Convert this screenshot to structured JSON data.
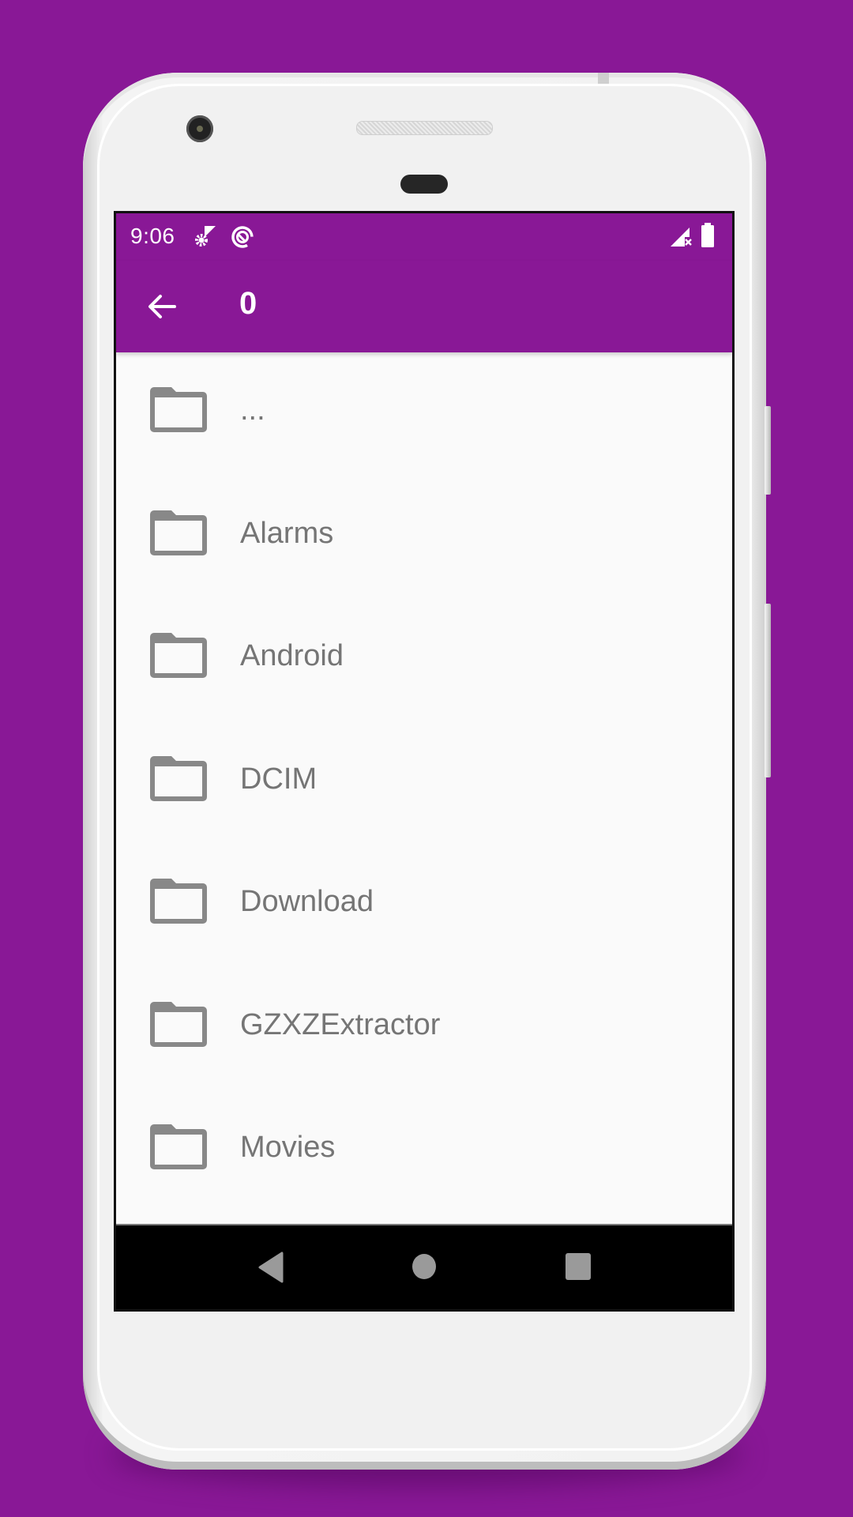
{
  "colors": {
    "background": "#891896",
    "app_bar": "#891896",
    "list_background": "#fafafa",
    "text_secondary": "#757575",
    "icon_gray": "#888888",
    "nav_bar": "#000000",
    "nav_icon": "#9a9a9a"
  },
  "status_bar": {
    "time": "9:06",
    "left_icons": [
      "settings-sync-icon",
      "data-saver-icon"
    ],
    "right_icons": [
      "no-signal-icon",
      "battery-full-icon"
    ]
  },
  "toolbar": {
    "back_icon": "arrow-back-icon",
    "title": "0"
  },
  "file_list": {
    "items": [
      {
        "name": "...",
        "icon": "folder-icon"
      },
      {
        "name": "Alarms",
        "icon": "folder-icon"
      },
      {
        "name": "Android",
        "icon": "folder-icon"
      },
      {
        "name": "DCIM",
        "icon": "folder-icon"
      },
      {
        "name": "Download",
        "icon": "folder-icon"
      },
      {
        "name": "GZXZExtractor",
        "icon": "folder-icon"
      },
      {
        "name": "Movies",
        "icon": "folder-icon"
      }
    ]
  },
  "nav_bar": {
    "buttons": [
      "back-triangle-icon",
      "home-circle-icon",
      "recents-square-icon"
    ]
  }
}
